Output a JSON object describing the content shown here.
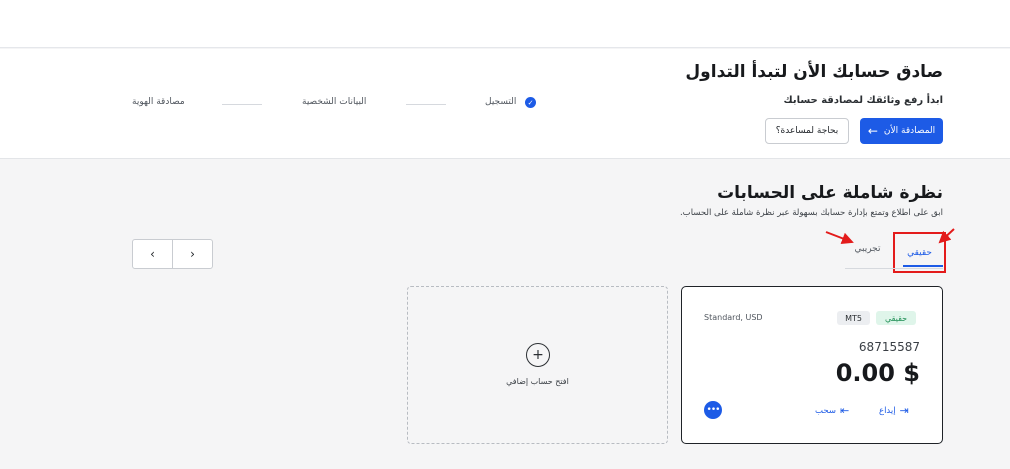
{
  "verification": {
    "title": "صادق حسابك الأن لتبدأ التداول",
    "subtitle": "ابدأ رفع وثائقك لمصادقة حسابك",
    "verify_now_label": "المصادقة الأن",
    "need_help_label": "بحاجة لمساعدة؟",
    "steps": [
      {
        "label": "التسجيل",
        "done": true
      },
      {
        "label": "البيانات الشخصية",
        "done": false
      },
      {
        "label": "مصادقة الهوية",
        "done": false
      }
    ]
  },
  "accounts": {
    "title": "نظرة شاملة على الحسابات",
    "subtitle": "ابق على اطلاع وتمتع بإدارة حسابك بسهولة عبر نظرة شاملة على الحساب.",
    "tabs": [
      {
        "label": "حقيقي",
        "active": true
      },
      {
        "label": "تجريبي",
        "active": false
      }
    ],
    "pager": {
      "prev": "‹",
      "next": "›"
    },
    "cards": [
      {
        "badge": "حقيقي",
        "platform": "MT5",
        "type": "Standard, USD",
        "number": "68715587",
        "balance": "0.00 $",
        "deposit_label": "إيداع",
        "withdraw_label": "سحب"
      }
    ],
    "add_account_label": "افتح حساب إضافي"
  },
  "colors": {
    "accent": "#1d5be6",
    "highlight": "#e31b1b",
    "success": "#1f8f55"
  }
}
